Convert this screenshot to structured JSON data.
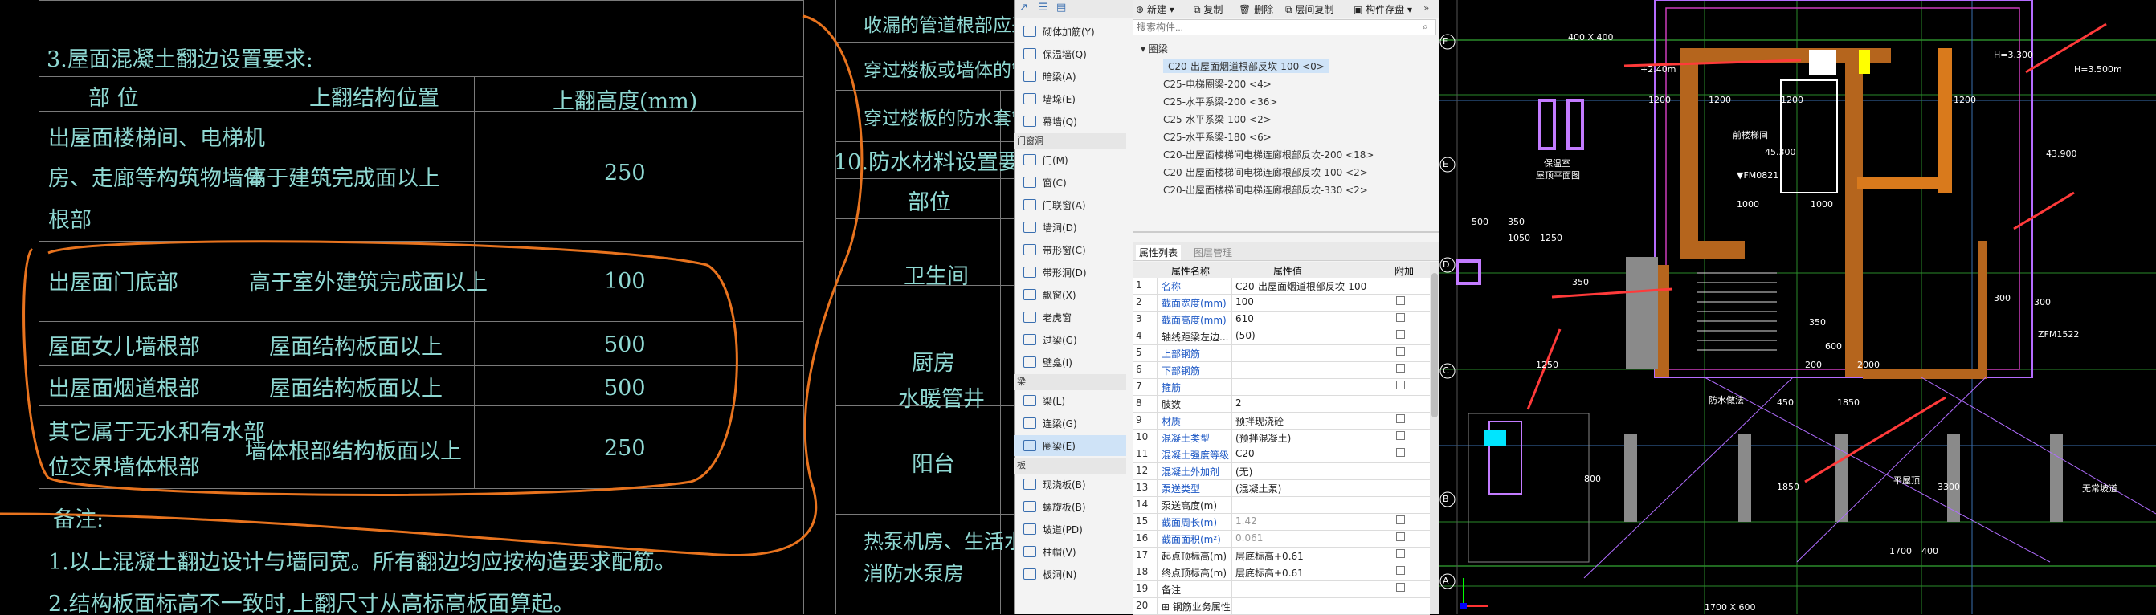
{
  "left_table": {
    "section_title": "3.屋面混凝土翻边设置要求:",
    "headers": [
      "部      位",
      "上翻结构位置",
      "上翻高度(mm)"
    ],
    "rows": [
      {
        "part": [
          "出屋面楼梯间、电梯机",
          "房、走廊等构筑物墙体",
          "根部"
        ],
        "position": "高于建筑完成面以上",
        "height": "250"
      },
      {
        "part": [
          "出屋面门底部"
        ],
        "position": "高于室外建筑完成面以上",
        "height": "100"
      },
      {
        "part": [
          "屋面女儿墙根部"
        ],
        "position": "屋面结构板面以上",
        "height": "500"
      },
      {
        "part": [
          "出屋面烟道根部"
        ],
        "position": "屋面结构板面以上",
        "height": "500"
      },
      {
        "part": [
          "其它属于无水和有水部",
          "位交界墙体根部"
        ],
        "position": "墙体根部结构板面以上",
        "height": "250"
      }
    ],
    "notes_title": "备注:",
    "notes": [
      "1.以上混凝土翻边设计与墙同宽。所有翻边均应按构造要求配筋。",
      "2.结构板面标高不一致时,上翻尺寸从高标高板面算起。"
    ],
    "right_col_top": [
      "收漏的管道根部应采取留",
      "穿过楼板或墙体的管道套",
      "穿过楼板的防水套管应高出"
    ],
    "waterproof_title": "10.防水材料设置要求",
    "waterproof_header": "部位",
    "waterproof_rooms": [
      "卫生间",
      "厨房",
      "水暖管井",
      "阳台",
      "热泵机房、生活水",
      "消防水泵房"
    ]
  },
  "software": {
    "toolbar_icons": [
      "arrow-icon",
      "list-view-icon",
      "detail-view-icon"
    ],
    "top_buttons": [
      "新建",
      "复制",
      "删除",
      "层间复制",
      "构件存盘"
    ],
    "search_placeholder": "搜索构件...",
    "nav": [
      {
        "type": "item",
        "label": "砌体加筋(Y)"
      },
      {
        "type": "item",
        "label": "保温墙(Q)"
      },
      {
        "type": "item",
        "label": "暗梁(A)"
      },
      {
        "type": "item",
        "label": "墙垛(E)"
      },
      {
        "type": "item",
        "label": "幕墙(Q)"
      },
      {
        "type": "head",
        "label": "门窗洞"
      },
      {
        "type": "item",
        "label": "门(M)"
      },
      {
        "type": "item",
        "label": "窗(C)"
      },
      {
        "type": "item",
        "label": "门联窗(A)"
      },
      {
        "type": "item",
        "label": "墙洞(D)"
      },
      {
        "type": "item",
        "label": "带形窗(C)"
      },
      {
        "type": "item",
        "label": "带形洞(D)"
      },
      {
        "type": "item",
        "label": "飘窗(X)"
      },
      {
        "type": "item",
        "label": "老虎窗"
      },
      {
        "type": "item",
        "label": "过梁(G)"
      },
      {
        "type": "item",
        "label": "壁龛(I)"
      },
      {
        "type": "head",
        "label": "梁"
      },
      {
        "type": "item",
        "label": "梁(L)"
      },
      {
        "type": "item",
        "label": "连梁(G)"
      },
      {
        "type": "item",
        "label": "圈梁(E)",
        "selected": true
      },
      {
        "type": "head",
        "label": "板"
      },
      {
        "type": "item",
        "label": "现浇板(B)"
      },
      {
        "type": "item",
        "label": "螺旋板(B)"
      },
      {
        "type": "item",
        "label": "坡道(PD)"
      },
      {
        "type": "item",
        "label": "柱帽(V)"
      },
      {
        "type": "item",
        "label": "板洞(N)"
      }
    ],
    "tree_root": "圈梁",
    "tree_items": [
      "C20-出屋面烟道根部反坎-100 <0>",
      "C25-电梯圈梁-200 <4>",
      "C25-水平系梁-200 <36>",
      "C25-水平系梁-100 <2>",
      "C25-水平系梁-180 <6>",
      "C20-出屋面楼梯间电梯连廊根部反坎-200 <18>",
      "C20-出屋面楼梯间电梯连廊根部反坎-100 <2>",
      "C20-出屋面楼梯间电梯连廊根部反坎-330 <2>"
    ],
    "tabs": [
      "属性列表",
      "图层管理"
    ],
    "prop_headers": [
      "属性名称",
      "属性值",
      "附加"
    ],
    "props": [
      {
        "n": "1",
        "name": "名称",
        "value": "C20-出屋面烟道根部反坎-100",
        "blue": true,
        "chk": false
      },
      {
        "n": "2",
        "name": "截面宽度(mm)",
        "value": "100",
        "blue": true,
        "chk": true
      },
      {
        "n": "3",
        "name": "截面高度(mm)",
        "value": "610",
        "blue": true,
        "chk": true
      },
      {
        "n": "4",
        "name": "轴线距梁左边...",
        "value": "(50)",
        "blue": false,
        "chk": true
      },
      {
        "n": "5",
        "name": "上部钢筋",
        "value": "",
        "blue": true,
        "chk": true
      },
      {
        "n": "6",
        "name": "下部钢筋",
        "value": "",
        "blue": true,
        "chk": true
      },
      {
        "n": "7",
        "name": "箍筋",
        "value": "",
        "blue": true,
        "chk": true
      },
      {
        "n": "8",
        "name": "肢数",
        "value": "2",
        "blue": false,
        "chk": false
      },
      {
        "n": "9",
        "name": "材质",
        "value": "预拌现浇砼",
        "blue": true,
        "chk": true
      },
      {
        "n": "10",
        "name": "混凝土类型",
        "value": "(预拌混凝土)",
        "blue": true,
        "chk": true
      },
      {
        "n": "11",
        "name": "混凝土强度等级",
        "value": "C20",
        "blue": true,
        "chk": true
      },
      {
        "n": "12",
        "name": "混凝土外加剂",
        "value": "(无)",
        "blue": true,
        "chk": false
      },
      {
        "n": "13",
        "name": "泵送类型",
        "value": "(混凝土泵)",
        "blue": true,
        "chk": false
      },
      {
        "n": "14",
        "name": "泵送高度(m)",
        "value": "",
        "blue": false,
        "chk": false
      },
      {
        "n": "15",
        "name": "截面周长(m)",
        "value": "1.42",
        "blue": true,
        "chk": true,
        "grey": true
      },
      {
        "n": "16",
        "name": "截面面积(m²)",
        "value": "0.061",
        "blue": true,
        "chk": true,
        "grey": true
      },
      {
        "n": "17",
        "name": "起点顶标高(m)",
        "value": "层底标高+0.61",
        "blue": false,
        "chk": true
      },
      {
        "n": "18",
        "name": "终点顶标高(m)",
        "value": "层底标高+0.61",
        "blue": false,
        "chk": true
      },
      {
        "n": "19",
        "name": "备注",
        "value": "",
        "blue": false,
        "chk": true
      },
      {
        "n": "20",
        "name": "⊞ 钢筋业务属性",
        "value": "",
        "blue": false,
        "chk": false
      }
    ]
  },
  "right_plan": {
    "labels": [
      "400 X 400",
      "+2.40m",
      "H=3.500m",
      "H=3.300",
      "1200",
      "1200",
      "1200",
      "1200",
      "前楼梯间",
      "45.300",
      "▼FM0821",
      "1000",
      "1000",
      "43.900",
      "1050",
      "1250",
      "350",
      "350",
      "500",
      "1250",
      "350",
      "600",
      "200",
      "300",
      "300",
      "保温室",
      "屋顶平面图",
      "防水做法",
      "平屋顶",
      "450",
      "1850",
      "1700",
      "400",
      "2000",
      "800",
      "1850",
      "3300",
      "无常坡道",
      "1700 X 600",
      "ZFM1522"
    ],
    "axis": [
      "F",
      "E",
      "D",
      "C",
      "B",
      "A"
    ]
  }
}
